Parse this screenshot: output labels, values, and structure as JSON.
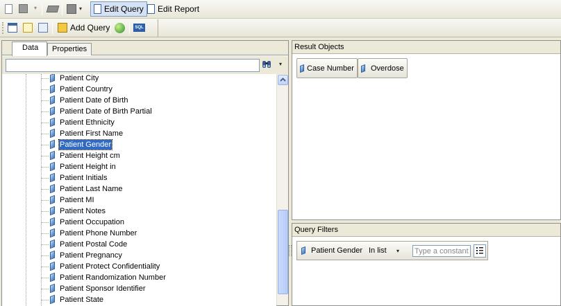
{
  "toolbar1": {
    "edit_query": "Edit Query",
    "edit_report": "Edit Report"
  },
  "toolbar2": {
    "add_query": "Add Query",
    "sql_label": "SQL"
  },
  "left_panel": {
    "tabs": [
      {
        "label": "Data"
      },
      {
        "label": "Properties"
      }
    ],
    "search": {
      "value": "",
      "placeholder": ""
    },
    "items": [
      {
        "label": "Patient City"
      },
      {
        "label": "Patient Country"
      },
      {
        "label": "Patient Date of Birth"
      },
      {
        "label": "Patient Date of Birth Partial"
      },
      {
        "label": "Patient Ethnicity"
      },
      {
        "label": "Patient First Name"
      },
      {
        "label": "Patient Gender"
      },
      {
        "label": "Patient Height cm"
      },
      {
        "label": "Patient Height in"
      },
      {
        "label": "Patient Initials"
      },
      {
        "label": "Patient Last Name"
      },
      {
        "label": "Patient MI"
      },
      {
        "label": "Patient Notes"
      },
      {
        "label": "Patient Occupation"
      },
      {
        "label": "Patient Phone Number"
      },
      {
        "label": "Patient Postal Code"
      },
      {
        "label": "Patient Pregnancy"
      },
      {
        "label": "Patient Protect Confidentiality"
      },
      {
        "label": "Patient Randomization Number"
      },
      {
        "label": "Patient Sponsor Identifier"
      },
      {
        "label": "Patient State"
      }
    ],
    "selected_item": "Patient Gender"
  },
  "result_objects": {
    "title": "Result Objects",
    "objects": [
      {
        "label": "Case Number"
      },
      {
        "label": "Overdose"
      }
    ]
  },
  "query_filters": {
    "title": "Query Filters",
    "filter": {
      "field": "Patient Gender",
      "operator": "In list",
      "constant_placeholder": "Type a constant"
    }
  },
  "colors": {
    "accent": "#316ac5",
    "background": "#ece9d8"
  },
  "icons": [
    "new-document-icon",
    "save-icon",
    "print-icon",
    "layout-icon",
    "edit-query-icon",
    "edit-report-icon",
    "view-structure-icon",
    "view-data-icon",
    "data-manager-icon",
    "add-query-icon",
    "refresh-icon",
    "sql-icon",
    "binoculars-icon",
    "field-icon"
  ]
}
